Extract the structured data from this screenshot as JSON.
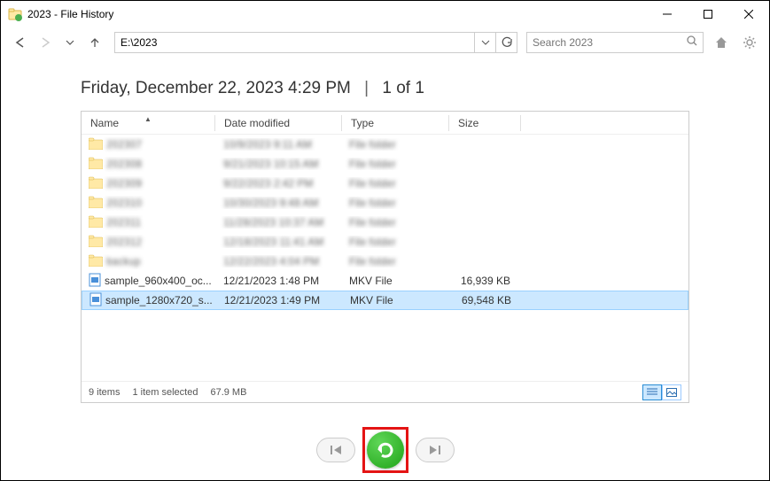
{
  "window": {
    "title": "2023 - File History"
  },
  "nav": {
    "address": "E:\\2023",
    "search_placeholder": "Search 2023"
  },
  "header": {
    "datetime": "Friday, December 22, 2023 4:29 PM",
    "position": "1 of 1"
  },
  "columns": {
    "name": "Name",
    "date": "Date modified",
    "type": "Type",
    "size": "Size"
  },
  "rows": [
    {
      "name": "202307",
      "date": "10/9/2023 9:11 AM",
      "type": "File folder",
      "size": "",
      "is_folder": true,
      "blurred": true
    },
    {
      "name": "202308",
      "date": "9/21/2023 10:15 AM",
      "type": "File folder",
      "size": "",
      "is_folder": true,
      "blurred": true
    },
    {
      "name": "202309",
      "date": "9/22/2023 2:42 PM",
      "type": "File folder",
      "size": "",
      "is_folder": true,
      "blurred": true
    },
    {
      "name": "202310",
      "date": "10/30/2023 9:48 AM",
      "type": "File folder",
      "size": "",
      "is_folder": true,
      "blurred": true
    },
    {
      "name": "202311",
      "date": "11/28/2023 10:37 AM",
      "type": "File folder",
      "size": "",
      "is_folder": true,
      "blurred": true
    },
    {
      "name": "202312",
      "date": "12/18/2023 11:41 AM",
      "type": "File folder",
      "size": "",
      "is_folder": true,
      "blurred": true
    },
    {
      "name": "backup",
      "date": "12/22/2023 4:04 PM",
      "type": "File folder",
      "size": "",
      "is_folder": true,
      "blurred": true
    },
    {
      "name": "sample_960x400_oc...",
      "date": "12/21/2023 1:48 PM",
      "type": "MKV File",
      "size": "16,939 KB",
      "is_folder": false,
      "blurred": false
    },
    {
      "name": "sample_1280x720_s...",
      "date": "12/21/2023 1:49 PM",
      "type": "MKV File",
      "size": "69,548 KB",
      "is_folder": false,
      "blurred": false,
      "selected": true
    }
  ],
  "status": {
    "items": "9 items",
    "selected": "1 item selected",
    "size": "67.9 MB"
  }
}
